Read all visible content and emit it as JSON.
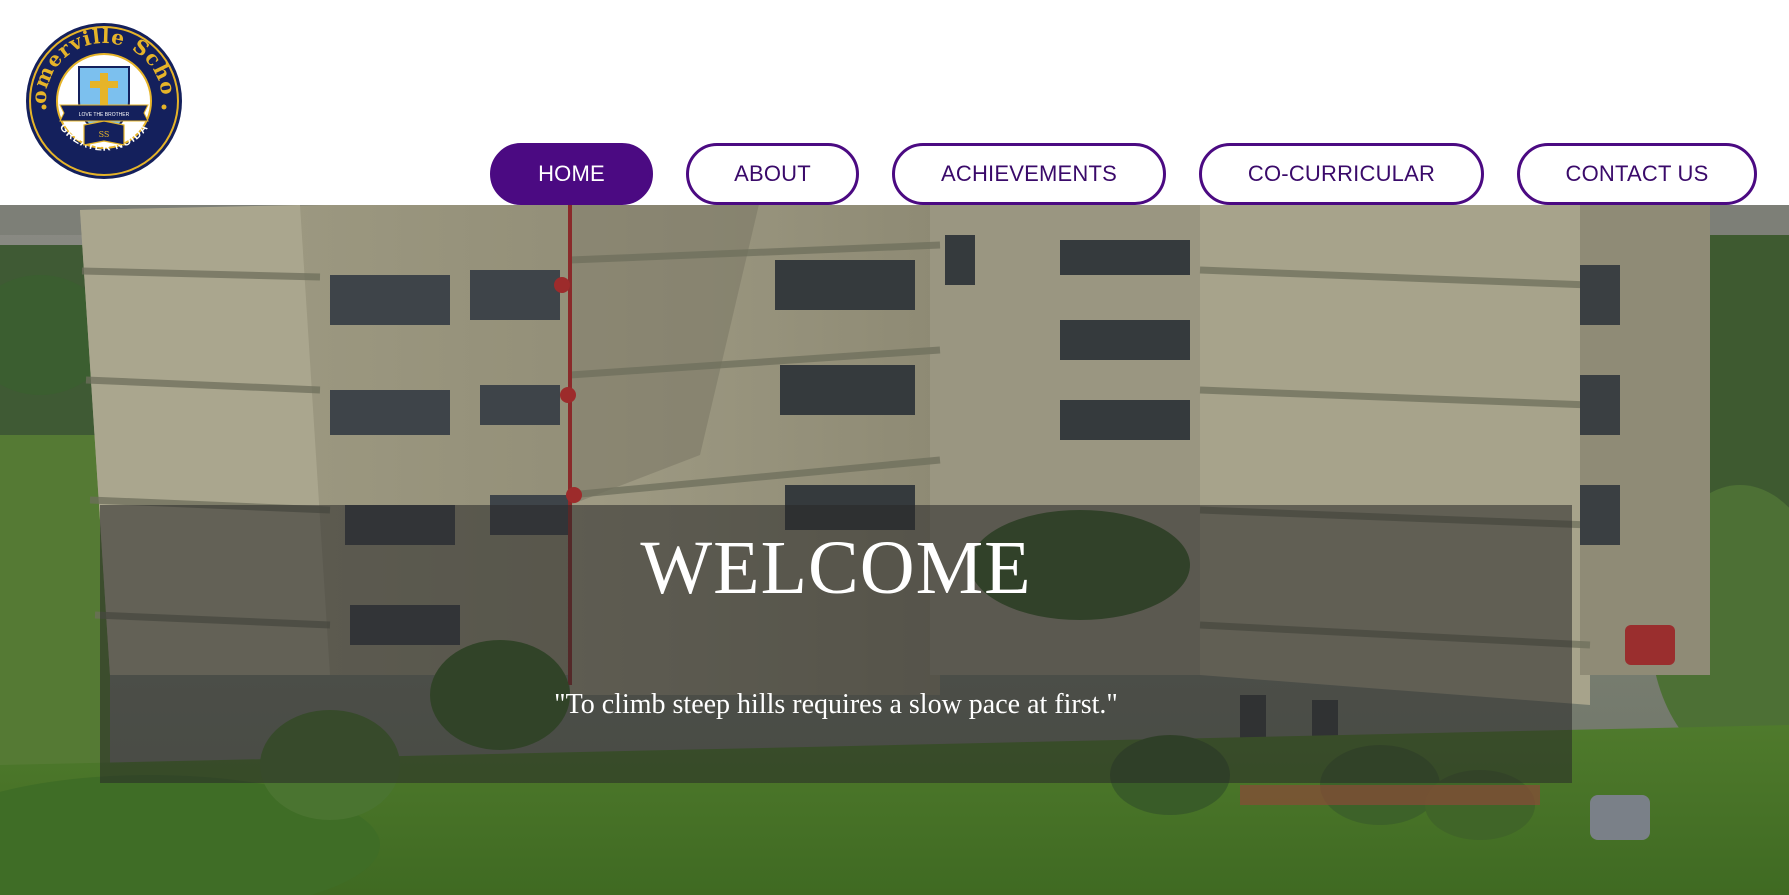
{
  "logo": {
    "school_name": "Somerville School",
    "location": "GREATER NOIDA",
    "motto": "LOVE THE BROTHER",
    "crest_initials": "SS",
    "colors": {
      "navy": "#14205c",
      "gold": "#e6b429",
      "sky": "#7cc0ee"
    }
  },
  "nav": {
    "items": [
      {
        "label": "HOME",
        "active": true
      },
      {
        "label": "ABOUT",
        "active": false
      },
      {
        "label": "ACHIEVEMENTS",
        "active": false
      },
      {
        "label": "CO-CURRICULAR",
        "active": false
      },
      {
        "label": "CONTACT US",
        "active": false
      }
    ],
    "accent_color": "#4b0a82"
  },
  "hero": {
    "title": "WELCOME",
    "quote": "\"To climb steep hills requires a slow pace at first.\""
  }
}
